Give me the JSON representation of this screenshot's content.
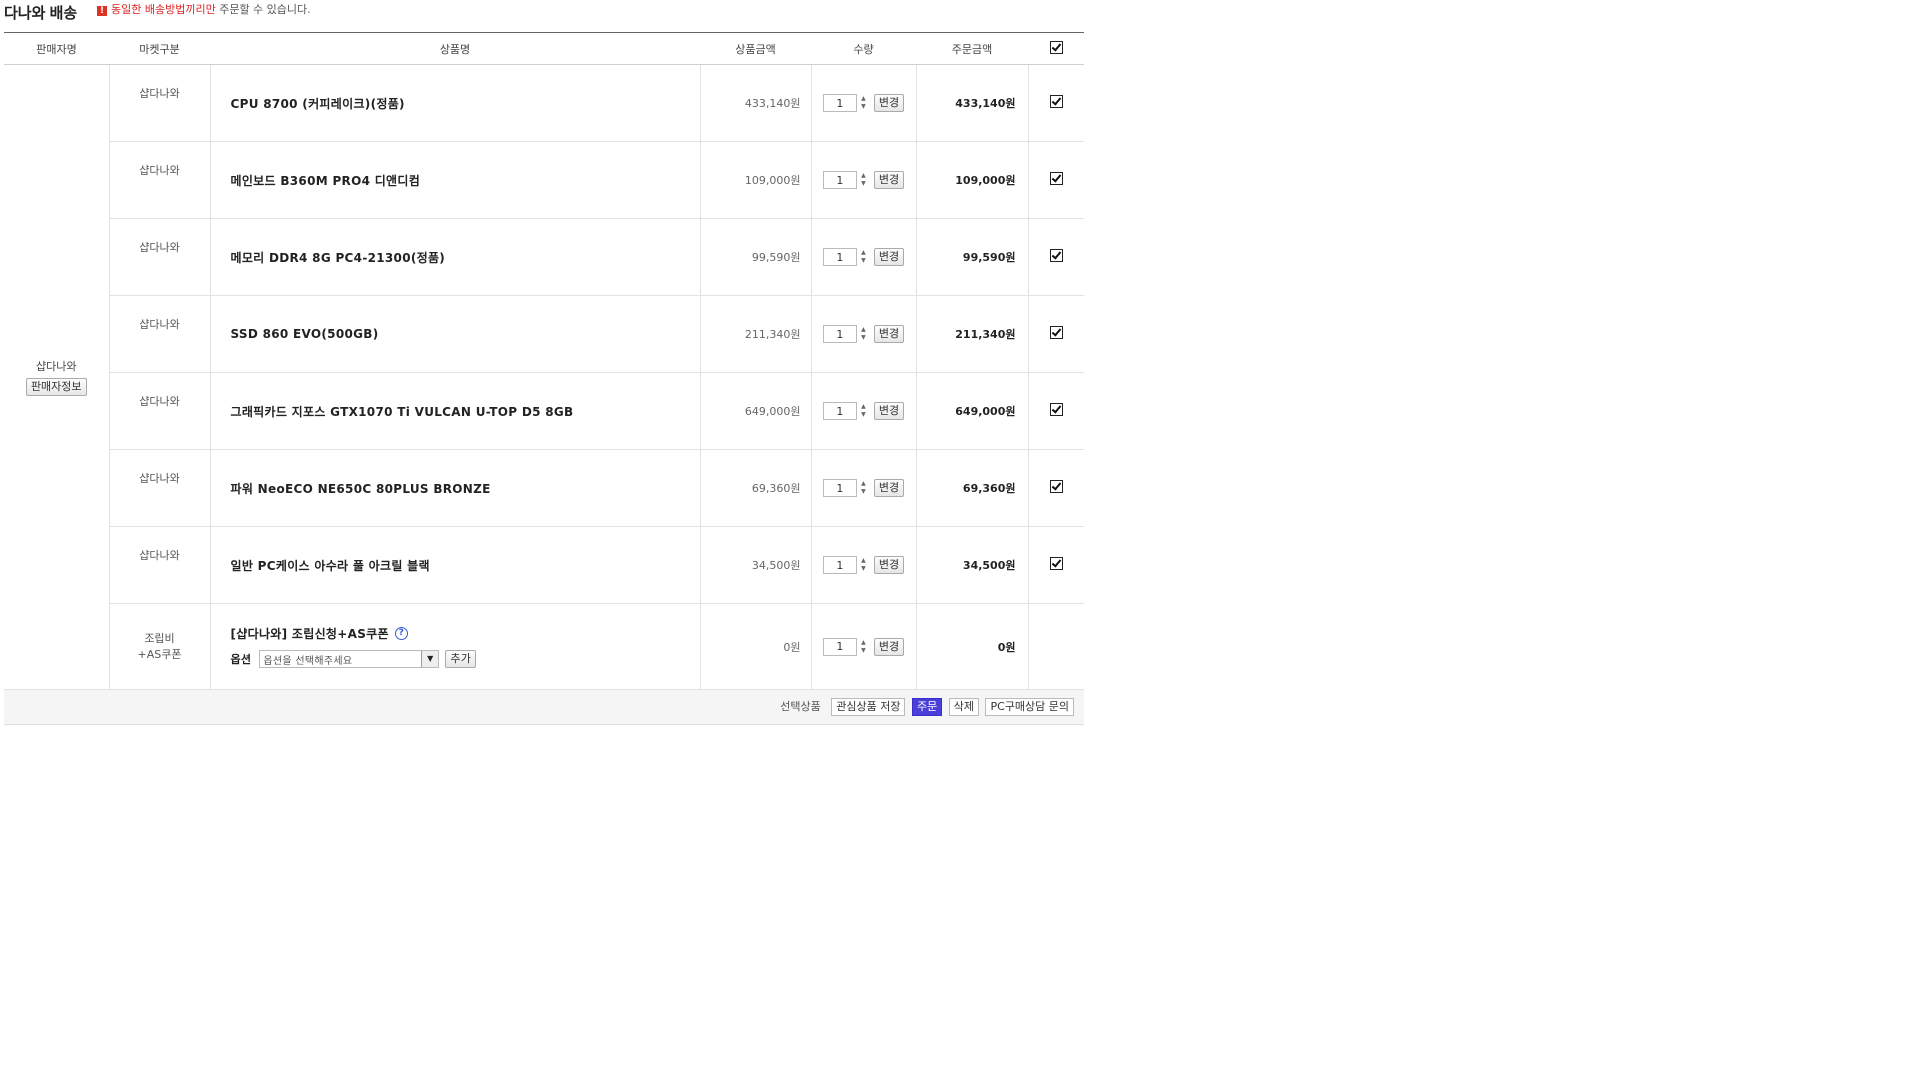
{
  "header": {
    "title": "다나와 배송",
    "notice_highlight": "동일한 배송방법끼리만",
    "notice_rest": " 주문할 수 있습니다."
  },
  "columns": [
    "판매자명",
    "마켓구분",
    "상품명",
    "상품금액",
    "수량",
    "주문금액"
  ],
  "seller": {
    "name": "샵다나와",
    "info_button": "판매자정보"
  },
  "items": [
    {
      "market": "샵다나와",
      "name": "CPU 8700 (커피레이크)(정품)",
      "price": "433,140원",
      "qty": "1",
      "total": "433,140원"
    },
    {
      "market": "샵다나와",
      "name": "메인보드 B360M PRO4 디앤디컴",
      "price": "109,000원",
      "qty": "1",
      "total": "109,000원"
    },
    {
      "market": "샵다나와",
      "name": "메모리 DDR4 8G PC4-21300(정품)",
      "price": "99,590원",
      "qty": "1",
      "total": "99,590원"
    },
    {
      "market": "샵다나와",
      "name": "SSD 860 EVO(500GB)",
      "price": "211,340원",
      "qty": "1",
      "total": "211,340원"
    },
    {
      "market": "샵다나와",
      "name": "그래픽카드 지포스 GTX1070 Ti VULCAN U-TOP D5 8GB",
      "price": "649,000원",
      "qty": "1",
      "total": "649,000원"
    },
    {
      "market": "샵다나와",
      "name": "파워 NeoECO NE650C 80PLUS BRONZE",
      "price": "69,360원",
      "qty": "1",
      "total": "69,360원"
    },
    {
      "market": "샵다나와",
      "name": "일반 PC케이스 아수라 풀 아크릴 블랙",
      "price": "34,500원",
      "qty": "1",
      "total": "34,500원"
    }
  ],
  "change_label": "변경",
  "assembly": {
    "market_line1": "조립비",
    "market_line2": "+AS쿠폰",
    "name": "[샵다나와] 조립신청+AS쿠폰",
    "help_icon": "?",
    "option_label": "옵션",
    "option_placeholder": "옵션을 선택해주세요",
    "add_button": "추가",
    "price": "0원",
    "qty": "1",
    "total": "0원"
  },
  "footer": {
    "label": "선택상품",
    "buttons": {
      "wishlist": "관심상품 저장",
      "order": "주문",
      "delete": "삭제",
      "consult": "PC구매상담 문의"
    }
  },
  "icons": {
    "warning": "!",
    "spin_up": "▲",
    "spin_down": "▼",
    "select_arrow": "▼"
  },
  "colors": {
    "accent": "#4a3fd8",
    "warning": "#dd2222"
  }
}
